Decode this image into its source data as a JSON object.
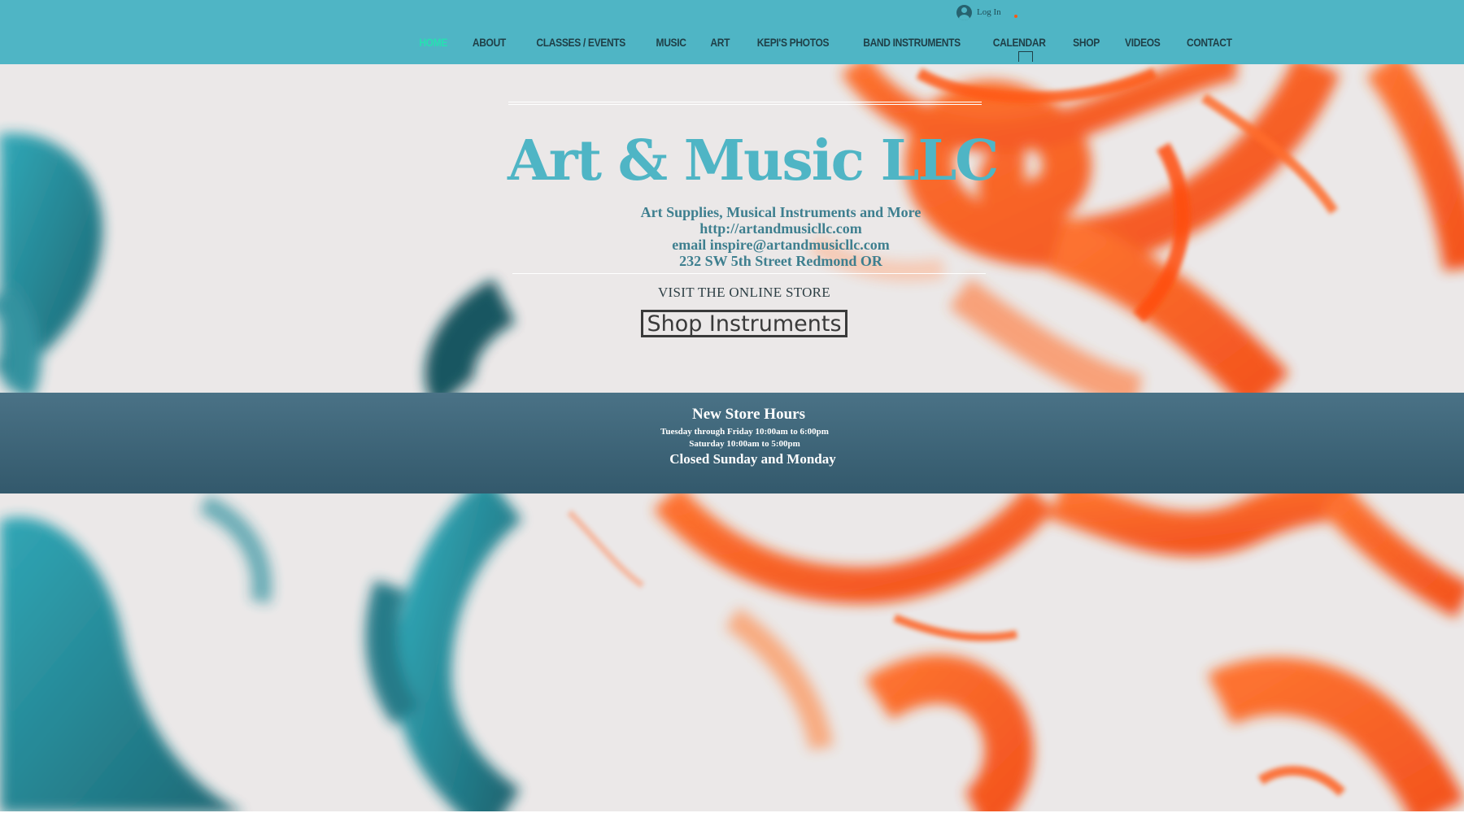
{
  "header": {
    "login_label": "Log In",
    "nav": [
      {
        "label": "HOME",
        "active": true
      },
      {
        "label": "ABOUT"
      },
      {
        "label": "CLASSES / EVENTS"
      },
      {
        "label": "MUSIC"
      },
      {
        "label": "ART"
      },
      {
        "label": "KEPI'S PHOTOS"
      },
      {
        "label": "BAND INSTRUMENTS"
      },
      {
        "label": "CALENDAR"
      },
      {
        "label": "SHOP"
      },
      {
        "label": "VIDEOS"
      },
      {
        "label": "CONTACT"
      }
    ]
  },
  "hero": {
    "title": "Art & Music LLC",
    "info_lines": [
      "Art Supplies, Musical Instruments and More",
      "http://artandmusicllc.com",
      "email inspire@artandmusicllc.com",
      "232 SW 5th Street Redmond OR"
    ],
    "visit_text": "VISIT THE ONLINE STORE",
    "shop_button": "Shop Instruments"
  },
  "hours": {
    "title": "New Store Hours",
    "line1": "Tuesday through Friday 10:00am to 6:00pm",
    "line2": "Saturday  10:00am to 5:00pm",
    "closed": "Closed Sunday and Monday"
  },
  "colors": {
    "header_bg": "#4fb5c5",
    "accent_teal": "#4fb5c5",
    "nav_active": "#27e0b2",
    "ink_orange": "#fb5a13",
    "ink_teal": "#1f8a99",
    "hours_band": "#3d6478"
  },
  "icons": {
    "login": "user-avatar-icon",
    "cart": "cart-dot-icon"
  }
}
